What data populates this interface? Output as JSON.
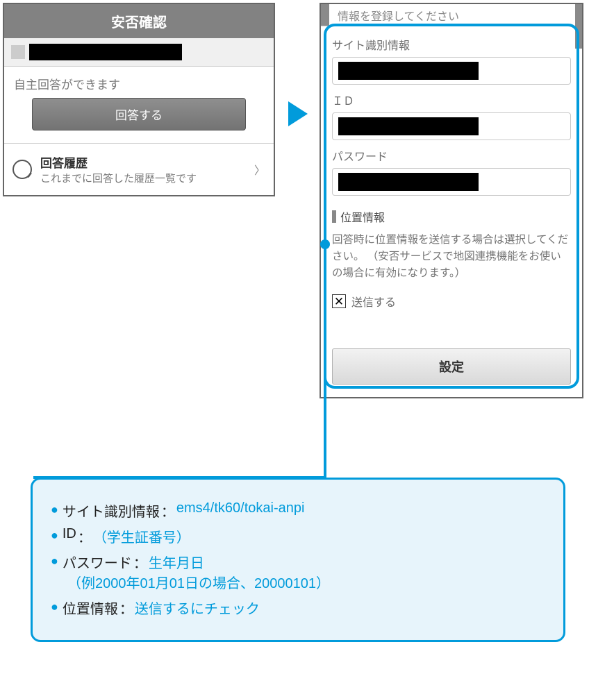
{
  "left_panel": {
    "header": "安否確認",
    "self_answer_msg": "自主回答ができます",
    "answer_button": "回答する",
    "history_title": "回答履歴",
    "history_desc": "これまでに回答した履歴一覧です"
  },
  "right_panel": {
    "top_text": "情報を登録してください",
    "site_label": "サイト識別情報",
    "id_label": "ＩＤ",
    "password_label": "パスワード",
    "location_header": "位置情報",
    "location_desc": "回答時に位置情報を送信する場合は選択してください。\n（安否サービスで地図連携機能をお使いの場合に有効になります。）",
    "send_checkbox_label": "送信する",
    "send_checked": true,
    "settings_button": "設定"
  },
  "callout": {
    "items": [
      {
        "key": "サイト識別情報",
        "value": "ems4/tk60/tokai-anpi"
      },
      {
        "key": "ID",
        "value": "（学生証番号）"
      },
      {
        "key": "パスワード",
        "value": "生年月日",
        "sub": "（例2000年01月01日の場合、20000101）"
      },
      {
        "key": "位置情報",
        "value": "送信するにチェック"
      }
    ]
  }
}
